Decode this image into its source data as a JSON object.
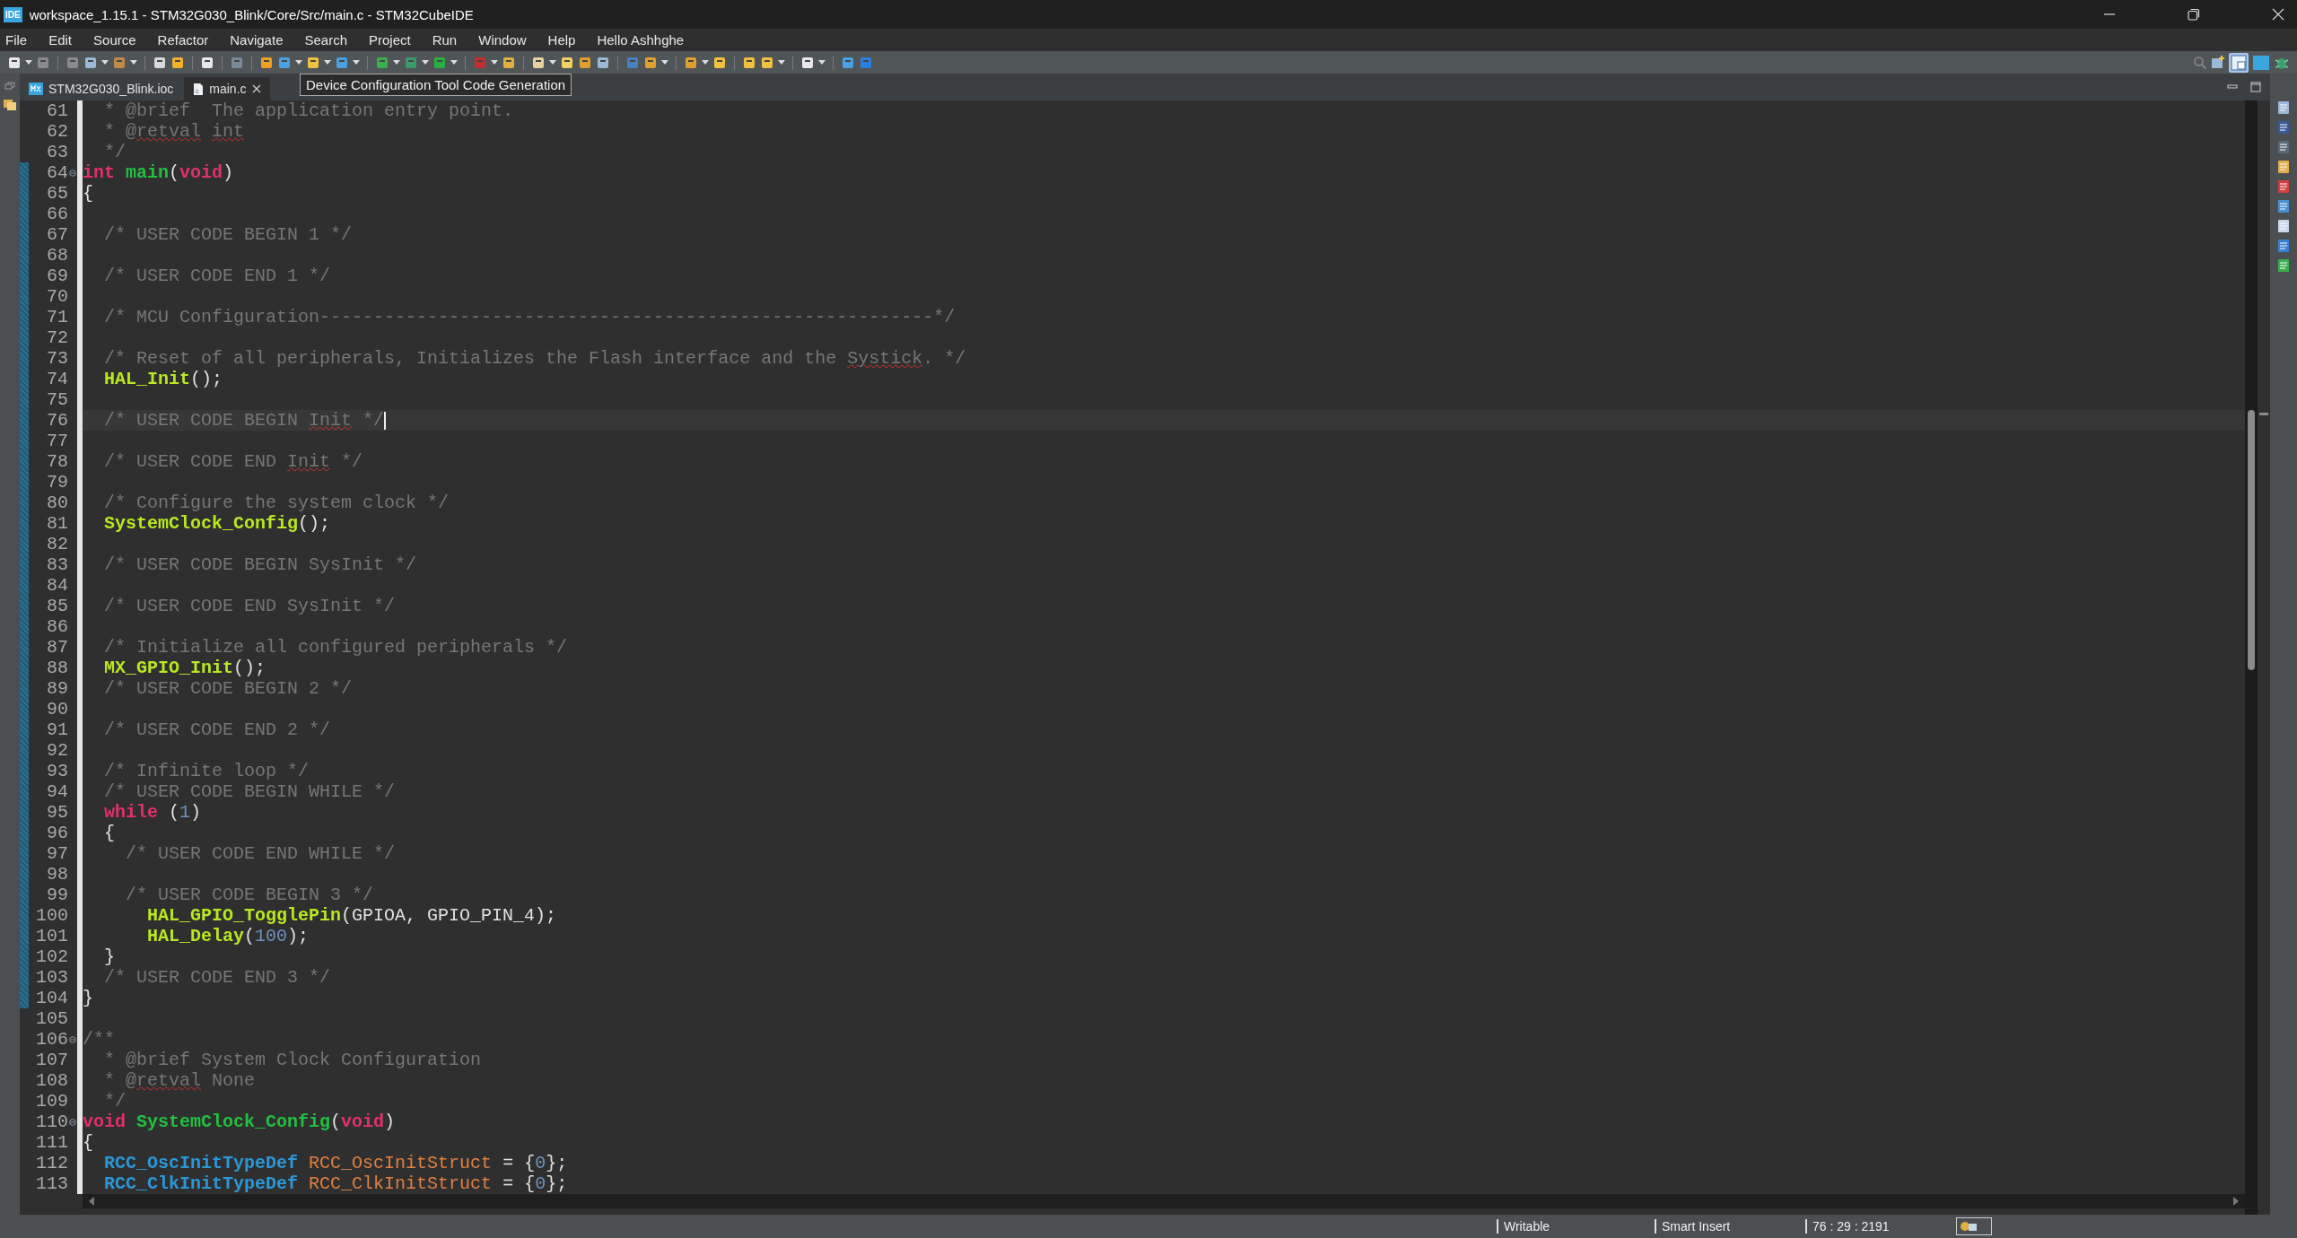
{
  "window": {
    "badge": "IDE",
    "title": "workspace_1.15.1 - STM32G030_Blink/Core/Src/main.c - STM32CubeIDE"
  },
  "menu": [
    "File",
    "Edit",
    "Source",
    "Refactor",
    "Navigate",
    "Search",
    "Project",
    "Run",
    "Window",
    "Help",
    "Hello Ashhghe"
  ],
  "tooltip": "Device Configuration Tool Code Generation",
  "tabs": [
    {
      "label": "STM32G030_Blink.ioc",
      "kind": "ioc",
      "selected": false
    },
    {
      "label": "main.c",
      "kind": "c",
      "selected": true
    }
  ],
  "editor": {
    "lines": [
      {
        "n": "61",
        "changed": false,
        "fold": false,
        "current": false,
        "tokens": [
          {
            "kind": "comment",
            "text": "  * @brief  The application entry point."
          }
        ]
      },
      {
        "n": "62",
        "changed": false,
        "fold": false,
        "current": false,
        "tokens": [
          {
            "kind": "comment",
            "text": "  * @"
          },
          {
            "kind": "spelling",
            "text": "retval"
          },
          {
            "kind": "spelling",
            "text": " int"
          }
        ]
      },
      {
        "n": "63",
        "changed": false,
        "fold": false,
        "current": false,
        "tokens": [
          {
            "kind": "comment",
            "text": "  */"
          }
        ]
      },
      {
        "n": "64",
        "changed": true,
        "fold": true,
        "current": false,
        "tokens": [
          {
            "kind": "keyword",
            "text": "int"
          },
          {
            "kind": "fn_def",
            "text": " main"
          },
          {
            "kind": "plain",
            "text": "("
          },
          {
            "kind": "keyword",
            "text": "void"
          },
          {
            "kind": "plain",
            "text": ")"
          }
        ]
      },
      {
        "n": "65",
        "changed": true,
        "fold": false,
        "current": false,
        "tokens": [
          {
            "kind": "plain",
            "text": "{"
          }
        ]
      },
      {
        "n": "66",
        "changed": true,
        "fold": false,
        "current": false
      },
      {
        "n": "67",
        "changed": true,
        "fold": false,
        "current": false,
        "tokens": [
          {
            "kind": "comment",
            "text": "  /* USER CODE BEGIN 1 */"
          }
        ]
      },
      {
        "n": "68",
        "changed": true,
        "fold": false,
        "current": false
      },
      {
        "n": "69",
        "changed": true,
        "fold": false,
        "current": false,
        "tokens": [
          {
            "kind": "comment",
            "text": "  /* USER CODE END 1 */"
          }
        ]
      },
      {
        "n": "70",
        "changed": true,
        "fold": false,
        "current": false
      },
      {
        "n": "71",
        "changed": true,
        "fold": false,
        "current": false,
        "tokens": [
          {
            "kind": "comment",
            "text": "  /* MCU Configuration---------------------------------------------------------*/"
          }
        ]
      },
      {
        "n": "72",
        "changed": true,
        "fold": false,
        "current": false
      },
      {
        "n": "73",
        "changed": true,
        "fold": false,
        "current": false,
        "tokens": [
          {
            "kind": "comment",
            "text": "  /* Reset of all peripherals, Initializes the Flash interface and the "
          },
          {
            "kind": "spelling",
            "text": "Systick"
          },
          {
            "kind": "comment",
            "text": ". */"
          }
        ]
      },
      {
        "n": "74",
        "changed": true,
        "fold": false,
        "current": false,
        "tokens": [
          {
            "kind": "fn_call",
            "text": "  HAL_Init"
          },
          {
            "kind": "plain",
            "text": "();"
          }
        ]
      },
      {
        "n": "75",
        "changed": true,
        "fold": false,
        "current": false
      },
      {
        "n": "76",
        "changed": true,
        "fold": false,
        "current": true,
        "tokens": [
          {
            "kind": "comment",
            "text": "  /* USER CODE BEGIN "
          },
          {
            "kind": "spelling",
            "text": "Init"
          },
          {
            "kind": "comment",
            "text": " */"
          }
        ]
      },
      {
        "n": "77",
        "changed": true,
        "fold": false,
        "current": false
      },
      {
        "n": "78",
        "changed": true,
        "fold": false,
        "current": false,
        "tokens": [
          {
            "kind": "comment",
            "text": "  /* USER CODE END "
          },
          {
            "kind": "spelling",
            "text": "Init"
          },
          {
            "kind": "comment",
            "text": " */"
          }
        ]
      },
      {
        "n": "79",
        "changed": true,
        "fold": false,
        "current": false
      },
      {
        "n": "80",
        "changed": true,
        "fold": false,
        "current": false,
        "tokens": [
          {
            "kind": "comment",
            "text": "  /* Configure the system clock */"
          }
        ]
      },
      {
        "n": "81",
        "changed": true,
        "fold": false,
        "current": false,
        "tokens": [
          {
            "kind": "fn_call",
            "text": "  SystemClock_Config"
          },
          {
            "kind": "plain",
            "text": "();"
          }
        ]
      },
      {
        "n": "82",
        "changed": true,
        "fold": false,
        "current": false
      },
      {
        "n": "83",
        "changed": true,
        "fold": false,
        "current": false,
        "tokens": [
          {
            "kind": "comment",
            "text": "  /* USER CODE BEGIN SysInit */"
          }
        ]
      },
      {
        "n": "84",
        "changed": true,
        "fold": false,
        "current": false
      },
      {
        "n": "85",
        "changed": true,
        "fold": false,
        "current": false,
        "tokens": [
          {
            "kind": "comment",
            "text": "  /* USER CODE END SysInit */"
          }
        ]
      },
      {
        "n": "86",
        "changed": true,
        "fold": false,
        "current": false
      },
      {
        "n": "87",
        "changed": true,
        "fold": false,
        "current": false,
        "tokens": [
          {
            "kind": "comment",
            "text": "  /* Initialize all configured peripherals */"
          }
        ]
      },
      {
        "n": "88",
        "changed": true,
        "fold": false,
        "current": false,
        "tokens": [
          {
            "kind": "fn_call",
            "text": "  MX_GPIO_Init"
          },
          {
            "kind": "plain",
            "text": "();"
          }
        ]
      },
      {
        "n": "89",
        "changed": true,
        "fold": false,
        "current": false,
        "tokens": [
          {
            "kind": "comment",
            "text": "  /* USER CODE BEGIN 2 */"
          }
        ]
      },
      {
        "n": "90",
        "changed": true,
        "fold": false,
        "current": false
      },
      {
        "n": "91",
        "changed": true,
        "fold": false,
        "current": false,
        "tokens": [
          {
            "kind": "comment",
            "text": "  /* USER CODE END 2 */"
          }
        ]
      },
      {
        "n": "92",
        "changed": true,
        "fold": false,
        "current": false
      },
      {
        "n": "93",
        "changed": true,
        "fold": false,
        "current": false,
        "tokens": [
          {
            "kind": "comment",
            "text": "  /* Infinite loop */"
          }
        ]
      },
      {
        "n": "94",
        "changed": true,
        "fold": false,
        "current": false,
        "tokens": [
          {
            "kind": "comment",
            "text": "  /* USER CODE BEGIN WHILE */"
          }
        ]
      },
      {
        "n": "95",
        "changed": true,
        "fold": false,
        "current": false,
        "tokens": [
          {
            "kind": "keyword",
            "text": "  while"
          },
          {
            "kind": "plain",
            "text": " ("
          },
          {
            "kind": "number",
            "text": "1"
          },
          {
            "kind": "plain",
            "text": ")"
          }
        ]
      },
      {
        "n": "96",
        "changed": true,
        "fold": false,
        "current": false,
        "tokens": [
          {
            "kind": "plain",
            "text": "  {"
          }
        ]
      },
      {
        "n": "97",
        "changed": true,
        "fold": false,
        "current": false,
        "tokens": [
          {
            "kind": "comment",
            "text": "    /* USER CODE END WHILE */"
          }
        ]
      },
      {
        "n": "98",
        "changed": true,
        "fold": false,
        "current": false
      },
      {
        "n": "99",
        "changed": true,
        "fold": false,
        "current": false,
        "tokens": [
          {
            "kind": "comment",
            "text": "    /* USER CODE BEGIN 3 */"
          }
        ]
      },
      {
        "n": "100",
        "changed": true,
        "fold": false,
        "current": false,
        "tokens": [
          {
            "kind": "fn_call",
            "text": "      HAL_GPIO_TogglePin"
          },
          {
            "kind": "plain",
            "text": "(GPIOA, GPIO_PIN_4);"
          }
        ]
      },
      {
        "n": "101",
        "changed": true,
        "fold": false,
        "current": false,
        "tokens": [
          {
            "kind": "fn_call",
            "text": "      HAL_Delay"
          },
          {
            "kind": "plain",
            "text": "("
          },
          {
            "kind": "number",
            "text": "100"
          },
          {
            "kind": "plain",
            "text": ");"
          }
        ]
      },
      {
        "n": "102",
        "changed": true,
        "fold": false,
        "current": false,
        "tokens": [
          {
            "kind": "plain",
            "text": "  }"
          }
        ]
      },
      {
        "n": "103",
        "changed": true,
        "fold": false,
        "current": false,
        "tokens": [
          {
            "kind": "comment",
            "text": "  /* USER CODE END 3 */"
          }
        ]
      },
      {
        "n": "104",
        "changed": true,
        "fold": false,
        "current": false,
        "tokens": [
          {
            "kind": "plain",
            "text": "}"
          }
        ]
      },
      {
        "n": "105",
        "changed": false,
        "fold": false,
        "current": false
      },
      {
        "n": "106",
        "changed": false,
        "fold": true,
        "current": false,
        "tokens": [
          {
            "kind": "comment",
            "text": "/**"
          }
        ]
      },
      {
        "n": "107",
        "changed": false,
        "fold": false,
        "current": false,
        "tokens": [
          {
            "kind": "comment",
            "text": "  * @brief System Clock Configuration"
          }
        ]
      },
      {
        "n": "108",
        "changed": false,
        "fold": false,
        "current": false,
        "tokens": [
          {
            "kind": "comment",
            "text": "  * @"
          },
          {
            "kind": "spelling",
            "text": "retval"
          },
          {
            "kind": "comment",
            "text": " None"
          }
        ]
      },
      {
        "n": "109",
        "changed": false,
        "fold": false,
        "current": false,
        "tokens": [
          {
            "kind": "comment",
            "text": "  */"
          }
        ]
      },
      {
        "n": "110",
        "changed": false,
        "fold": true,
        "current": false,
        "tokens": [
          {
            "kind": "keyword",
            "text": "void"
          },
          {
            "kind": "fn_def",
            "text": " SystemClock_Config"
          },
          {
            "kind": "plain",
            "text": "("
          },
          {
            "kind": "keyword",
            "text": "void"
          },
          {
            "kind": "plain",
            "text": ")"
          }
        ]
      },
      {
        "n": "111",
        "changed": false,
        "fold": false,
        "current": false,
        "tokens": [
          {
            "kind": "plain",
            "text": "{"
          }
        ]
      },
      {
        "n": "112",
        "changed": false,
        "fold": false,
        "current": false,
        "tokens": [
          {
            "kind": "type",
            "text": "  RCC_OscInitTypeDef"
          },
          {
            "kind": "variable",
            "text": " RCC_OscInitStruct"
          },
          {
            "kind": "plain",
            "text": " = {"
          },
          {
            "kind": "number",
            "text": "0"
          },
          {
            "kind": "plain",
            "text": "};"
          }
        ]
      },
      {
        "n": "113",
        "changed": false,
        "fold": false,
        "current": false,
        "tokens": [
          {
            "kind": "type",
            "text": "  RCC_ClkInitTypeDef"
          },
          {
            "kind": "variable",
            "text": " RCC_ClkInitStruct"
          },
          {
            "kind": "plain",
            "text": " = {"
          },
          {
            "kind": "number",
            "text": "0"
          },
          {
            "kind": "plain",
            "text": "};"
          }
        ]
      }
    ]
  },
  "status_bar": {
    "mode": "Writable",
    "insert": "Smart Insert",
    "position": "76 : 29 : 2191"
  }
}
